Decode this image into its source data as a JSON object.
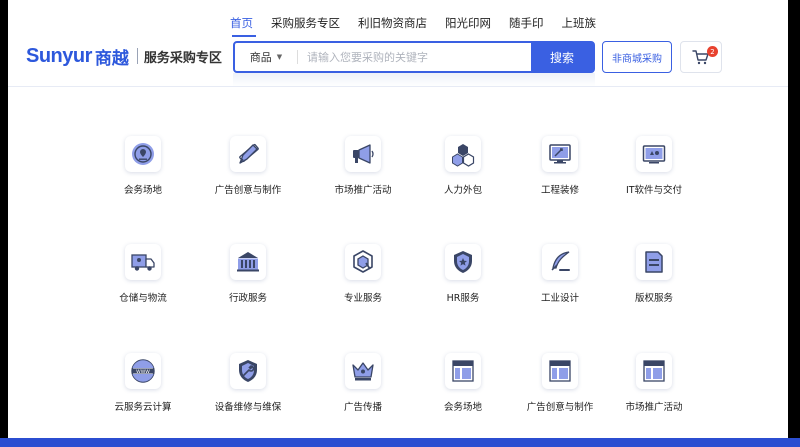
{
  "header": {
    "logo_en": "Sunyur",
    "logo_cn": "商越",
    "logo_sub": "服务采购专区",
    "nav": [
      "首页",
      "采购服务专区",
      "利旧物资商店",
      "阳光印网",
      "随手印",
      "上班族"
    ],
    "search": {
      "category": "商品",
      "placeholder": "请输入您要采购的关键字",
      "button": "搜索"
    },
    "nonmall_button": "非商城采购",
    "cart_count": "2"
  },
  "colors": {
    "brand": "#3a60e2",
    "icon_dark": "#3a4666",
    "icon_light": "#8f9ee8",
    "badge": "#e8412e"
  },
  "categories": [
    {
      "label": "会务场地",
      "icon": "location-pin-icon"
    },
    {
      "label": "广告创意与制作",
      "icon": "ruler-pencil-icon"
    },
    {
      "label": "市场推广活动",
      "icon": "megaphone-icon"
    },
    {
      "label": "人力外包",
      "icon": "hexagons-icon"
    },
    {
      "label": "工程装修",
      "icon": "monitor-tools-icon"
    },
    {
      "label": "IT软件与交付",
      "icon": "screen-shapes-icon"
    },
    {
      "label": "仓储与物流",
      "icon": "truck-icon"
    },
    {
      "label": "行政服务",
      "icon": "government-building-icon"
    },
    {
      "label": "专业服务",
      "icon": "hexagon-badge-icon"
    },
    {
      "label": "HR服务",
      "icon": "star-shield-icon"
    },
    {
      "label": "工业设计",
      "icon": "quill-pen-icon"
    },
    {
      "label": "版权服务",
      "icon": "document-icon"
    },
    {
      "label": "云服务云计算",
      "icon": "www-globe-icon"
    },
    {
      "label": "设备维修与维保",
      "icon": "wrench-shield-icon"
    },
    {
      "label": "广告传播",
      "icon": "crown-icon"
    },
    {
      "label": "会务场地",
      "icon": "layout-window-icon"
    },
    {
      "label": "广告创意与制作",
      "icon": "layout-window-icon"
    },
    {
      "label": "市场推广活动",
      "icon": "layout-window-icon"
    }
  ]
}
